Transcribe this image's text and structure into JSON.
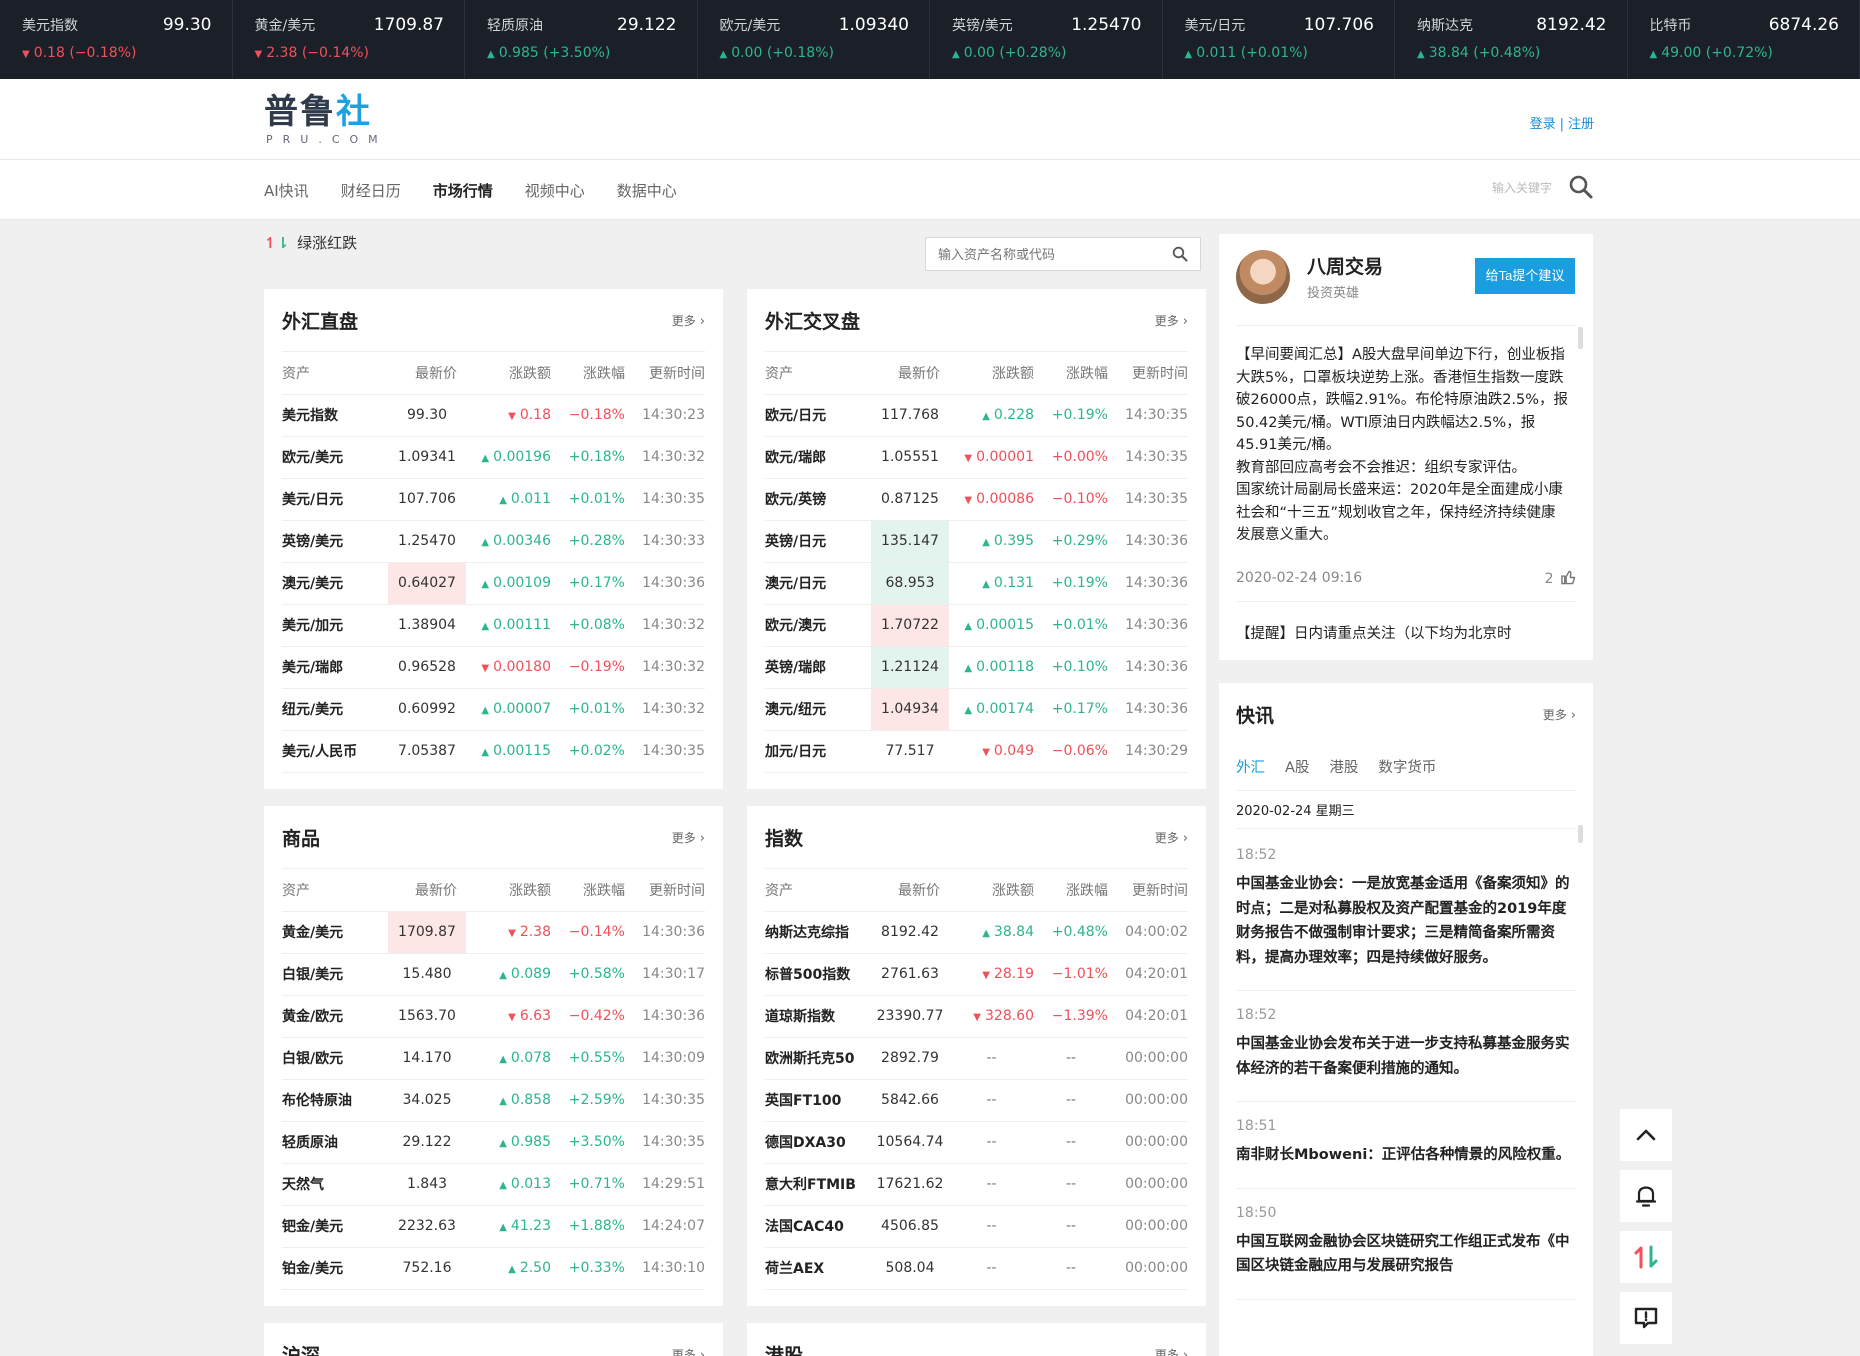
{
  "ticker": [
    {
      "name": "美元指数",
      "price": "99.30",
      "change": "0.18 (−0.18%)",
      "dir": "down"
    },
    {
      "name": "黄金/美元",
      "price": "1709.87",
      "change": "2.38 (−0.14%)",
      "dir": "down"
    },
    {
      "name": "轻质原油",
      "price": "29.122",
      "change": "0.985 (+3.50%)",
      "dir": "up"
    },
    {
      "name": "欧元/美元",
      "price": "1.09340",
      "change": "0.00 (+0.18%)",
      "dir": "up"
    },
    {
      "name": "英镑/美元",
      "price": "1.25470",
      "change": "0.00 (+0.28%)",
      "dir": "up"
    },
    {
      "name": "美元/日元",
      "price": "107.706",
      "change": "0.011 (+0.01%)",
      "dir": "up"
    },
    {
      "name": "纳斯达克",
      "price": "8192.42",
      "change": "38.84 (+0.48%)",
      "dir": "up"
    },
    {
      "name": "比特币",
      "price": "6874.26",
      "change": "49.00 (+0.72%)",
      "dir": "up"
    }
  ],
  "header": {
    "logo_text": "普鲁",
    "logo_accent": "社",
    "logo_sub": "PRU.COM",
    "login": "登录",
    "separator": "|",
    "register": "注册"
  },
  "nav": {
    "items": [
      "AI快讯",
      "财经日历",
      "市场行情",
      "视频中心",
      "数据中心"
    ],
    "active_index": 2,
    "search_placeholder": "输入关键字"
  },
  "toolbar": {
    "legend_label": "绿涨红跌",
    "asset_search_placeholder": "输入资产名称或代码"
  },
  "columns": [
    "资产",
    "最新价",
    "涨跌额",
    "涨跌幅",
    "更新时间"
  ],
  "more_label": "更多",
  "panels": [
    {
      "title": "外汇直盘",
      "rows": [
        {
          "name": "美元指数",
          "price": "99.30",
          "change": "0.18",
          "pct": "−0.18%",
          "time": "14:30:23",
          "dir": "down",
          "hl": ""
        },
        {
          "name": "欧元/美元",
          "price": "1.09341",
          "change": "0.00196",
          "pct": "+0.18%",
          "time": "14:30:32",
          "dir": "up",
          "hl": ""
        },
        {
          "name": "美元/日元",
          "price": "107.706",
          "change": "0.011",
          "pct": "+0.01%",
          "time": "14:30:35",
          "dir": "up",
          "hl": ""
        },
        {
          "name": "英镑/美元",
          "price": "1.25470",
          "change": "0.00346",
          "pct": "+0.28%",
          "time": "14:30:33",
          "dir": "up",
          "hl": ""
        },
        {
          "name": "澳元/美元",
          "price": "0.64027",
          "change": "0.00109",
          "pct": "+0.17%",
          "time": "14:30:36",
          "dir": "up",
          "hl": "red"
        },
        {
          "name": "美元/加元",
          "price": "1.38904",
          "change": "0.00111",
          "pct": "+0.08%",
          "time": "14:30:32",
          "dir": "up",
          "hl": ""
        },
        {
          "name": "美元/瑞郎",
          "price": "0.96528",
          "change": "0.00180",
          "pct": "−0.19%",
          "time": "14:30:32",
          "dir": "down",
          "hl": ""
        },
        {
          "name": "纽元/美元",
          "price": "0.60992",
          "change": "0.00007",
          "pct": "+0.01%",
          "time": "14:30:32",
          "dir": "up",
          "hl": ""
        },
        {
          "name": "美元/人民币",
          "price": "7.05387",
          "change": "0.00115",
          "pct": "+0.02%",
          "time": "14:30:35",
          "dir": "up",
          "hl": ""
        }
      ]
    },
    {
      "title": "外汇交叉盘",
      "rows": [
        {
          "name": "欧元/日元",
          "price": "117.768",
          "change": "0.228",
          "pct": "+0.19%",
          "time": "14:30:35",
          "dir": "up",
          "hl": ""
        },
        {
          "name": "欧元/瑞郎",
          "price": "1.05551",
          "change": "0.00001",
          "pct": "+0.00%",
          "time": "14:30:35",
          "dir": "down",
          "hl": ""
        },
        {
          "name": "欧元/英镑",
          "price": "0.87125",
          "change": "0.00086",
          "pct": "−0.10%",
          "time": "14:30:35",
          "dir": "down",
          "hl": ""
        },
        {
          "name": "英镑/日元",
          "price": "135.147",
          "change": "0.395",
          "pct": "+0.29%",
          "time": "14:30:36",
          "dir": "up",
          "hl": "green"
        },
        {
          "name": "澳元/日元",
          "price": "68.953",
          "change": "0.131",
          "pct": "+0.19%",
          "time": "14:30:36",
          "dir": "up",
          "hl": "green"
        },
        {
          "name": "欧元/澳元",
          "price": "1.70722",
          "change": "0.00015",
          "pct": "+0.01%",
          "time": "14:30:36",
          "dir": "up",
          "hl": "red"
        },
        {
          "name": "英镑/瑞郎",
          "price": "1.21124",
          "change": "0.00118",
          "pct": "+0.10%",
          "time": "14:30:36",
          "dir": "up",
          "hl": "green"
        },
        {
          "name": "澳元/纽元",
          "price": "1.04934",
          "change": "0.00174",
          "pct": "+0.17%",
          "time": "14:30:36",
          "dir": "up",
          "hl": "red"
        },
        {
          "name": "加元/日元",
          "price": "77.517",
          "change": "0.049",
          "pct": "−0.06%",
          "time": "14:30:29",
          "dir": "down",
          "hl": ""
        }
      ]
    },
    {
      "title": "商品",
      "rows": [
        {
          "name": "黄金/美元",
          "price": "1709.87",
          "change": "2.38",
          "pct": "−0.14%",
          "time": "14:30:36",
          "dir": "down",
          "hl": "red"
        },
        {
          "name": "白银/美元",
          "price": "15.480",
          "change": "0.089",
          "pct": "+0.58%",
          "time": "14:30:17",
          "dir": "up",
          "hl": ""
        },
        {
          "name": "黄金/欧元",
          "price": "1563.70",
          "change": "6.63",
          "pct": "−0.42%",
          "time": "14:30:36",
          "dir": "down",
          "hl": ""
        },
        {
          "name": "白银/欧元",
          "price": "14.170",
          "change": "0.078",
          "pct": "+0.55%",
          "time": "14:30:09",
          "dir": "up",
          "hl": ""
        },
        {
          "name": "布伦特原油",
          "price": "34.025",
          "change": "0.858",
          "pct": "+2.59%",
          "time": "14:30:35",
          "dir": "up",
          "hl": ""
        },
        {
          "name": "轻质原油",
          "price": "29.122",
          "change": "0.985",
          "pct": "+3.50%",
          "time": "14:30:35",
          "dir": "up",
          "hl": ""
        },
        {
          "name": "天然气",
          "price": "1.843",
          "change": "0.013",
          "pct": "+0.71%",
          "time": "14:29:51",
          "dir": "up",
          "hl": ""
        },
        {
          "name": "钯金/美元",
          "price": "2232.63",
          "change": "41.23",
          "pct": "+1.88%",
          "time": "14:24:07",
          "dir": "up",
          "hl": ""
        },
        {
          "name": "铂金/美元",
          "price": "752.16",
          "change": "2.50",
          "pct": "+0.33%",
          "time": "14:30:10",
          "dir": "up",
          "hl": ""
        }
      ]
    },
    {
      "title": "指数",
      "rows": [
        {
          "name": "纳斯达克综指",
          "price": "8192.42",
          "change": "38.84",
          "pct": "+0.48%",
          "time": "04:00:02",
          "dir": "up",
          "hl": ""
        },
        {
          "name": "标普500指数",
          "price": "2761.63",
          "change": "28.19",
          "pct": "−1.01%",
          "time": "04:20:01",
          "dir": "down",
          "hl": ""
        },
        {
          "name": "道琼斯指数",
          "price": "23390.77",
          "change": "328.60",
          "pct": "−1.39%",
          "time": "04:20:01",
          "dir": "down",
          "hl": ""
        },
        {
          "name": "欧洲斯托克50",
          "price": "2892.79",
          "change": "--",
          "pct": "--",
          "time": "00:00:00",
          "dir": "flat",
          "hl": ""
        },
        {
          "name": "英国FT100",
          "price": "5842.66",
          "change": "--",
          "pct": "--",
          "time": "00:00:00",
          "dir": "flat",
          "hl": ""
        },
        {
          "name": "德国DXA30",
          "price": "10564.74",
          "change": "--",
          "pct": "--",
          "time": "00:00:00",
          "dir": "flat",
          "hl": ""
        },
        {
          "name": "意大利FTMIB",
          "price": "17621.62",
          "change": "--",
          "pct": "--",
          "time": "00:00:00",
          "dir": "flat",
          "hl": ""
        },
        {
          "name": "法国CAC40",
          "price": "4506.85",
          "change": "--",
          "pct": "--",
          "time": "00:00:00",
          "dir": "flat",
          "hl": ""
        },
        {
          "name": "荷兰AEX",
          "price": "508.04",
          "change": "--",
          "pct": "--",
          "time": "00:00:00",
          "dir": "flat",
          "hl": ""
        }
      ]
    },
    {
      "title": "沪深",
      "rows": []
    },
    {
      "title": "港股",
      "rows": []
    }
  ],
  "profile": {
    "name": "八周交易",
    "role": "投资英雄",
    "button": "给Ta提个建议",
    "text": "【早间要闻汇总】A股大盘早间单边下行，创业板指大跌5%，口罩板块逆势上涨。香港恒生指数一度跌破26000点，跌幅2.91%。布伦特原油跌2.5%，报50.42美元/桶。WTI原油日内跌幅达2.5%，报45.91美元/桶。\n教育部回应高考会不会推迟：组织专家评估。\n国家统计局副局长盛来运：2020年是全面建成小康社会和“十三五”规划收官之年，保持经济持续健康发展意义重大。",
    "date": "2020-02-24 09:16",
    "likes": "2",
    "next_text": "【提醒】日内请重点关注（以下均为北京时"
  },
  "news": {
    "title": "快讯",
    "more": "更多",
    "tabs": [
      "外汇",
      "A股",
      "港股",
      "数字货币"
    ],
    "active_tab": 0,
    "date": "2020-02-24 星期三",
    "items": [
      {
        "time": "18:52",
        "text": "中国基金业协会：一是放宽基金适用《备案须知》的时点；二是对私募股权及资产配置基金的2019年度财务报告不做强制审计要求；三是精简备案所需资料，提高办理效率；四是持续做好服务。"
      },
      {
        "time": "18:52",
        "text": "中国基金业协会发布关于进一步支持私募基金服务实体经济的若干备案便利措施的通知。"
      },
      {
        "time": "18:51",
        "text": "南非财长Mboweni：正评估各种情景的风险权重。"
      },
      {
        "time": "18:50",
        "text": "中国互联网金融协会区块链研究工作组正式发布《中国区块链金融应用与发展研究报告"
      }
    ]
  },
  "colors": {
    "up": "#2cb58f",
    "down": "#f0505a",
    "accent": "#1a9ee0",
    "ticker_bg": "#1b1f27"
  },
  "icons": [
    "search-icon",
    "chevron-right-icon",
    "like-icon",
    "arrow-up-icon",
    "bell-icon",
    "up-down-icon",
    "feedback-icon"
  ]
}
